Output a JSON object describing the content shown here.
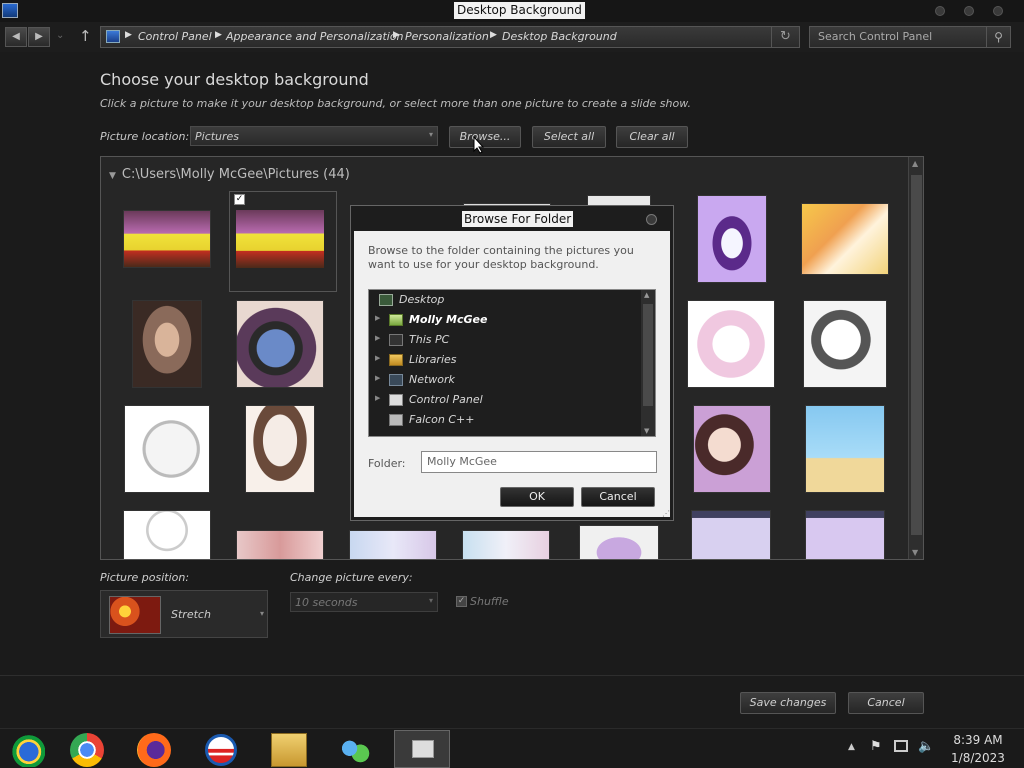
{
  "window": {
    "title": "Desktop Background"
  },
  "nav": {
    "breadcrumbs": [
      "Control Panel",
      "Appearance and Personalization",
      "Personalization",
      "Desktop Background"
    ],
    "search_placeholder": "Search Control Panel"
  },
  "main": {
    "heading": "Choose your desktop background",
    "subtext": "Click a picture to make it your desktop background, or select more than one picture to create a slide show.",
    "location_label": "Picture location:",
    "location_value": "Pictures",
    "browse_label": "Browse...",
    "select_all_label": "Select all",
    "clear_all_label": "Clear all",
    "folder_header": "C:\\Users\\Molly McGee\\Pictures (44)"
  },
  "dialog": {
    "title": "Browse For Folder",
    "description": "Browse to the folder containing the pictures you want to use for your desktop background.",
    "tree": [
      {
        "label": "Desktop",
        "icon": "desktop-icon",
        "bold": false
      },
      {
        "label": "Molly McGee",
        "icon": "user-folder-icon",
        "bold": true
      },
      {
        "label": "This PC",
        "icon": "computer-icon",
        "bold": false
      },
      {
        "label": "Libraries",
        "icon": "libraries-icon",
        "bold": false
      },
      {
        "label": "Network",
        "icon": "network-icon",
        "bold": false
      },
      {
        "label": "Control Panel",
        "icon": "control-panel-icon",
        "bold": false
      },
      {
        "label": "Falcon C++",
        "icon": "recycle-icon",
        "bold": false
      }
    ],
    "folder_label": "Folder:",
    "folder_value": "Molly McGee",
    "ok_label": "OK",
    "cancel_label": "Cancel"
  },
  "options": {
    "position_label": "Picture position:",
    "position_value": "Stretch",
    "change_label": "Change picture every:",
    "change_value": "10 seconds",
    "shuffle_label": "Shuffle",
    "shuffle_checked": true
  },
  "footer": {
    "save_label": "Save changes",
    "cancel_label": "Cancel"
  },
  "taskbar": {
    "apps": [
      "control-panel-icon",
      "chrome-icon",
      "firefox-icon",
      "obama-logo-icon",
      "file-explorer-icon",
      "network-people-icon",
      "active-window-icon"
    ],
    "time": "8:39 AM",
    "date": "1/8/2023"
  }
}
